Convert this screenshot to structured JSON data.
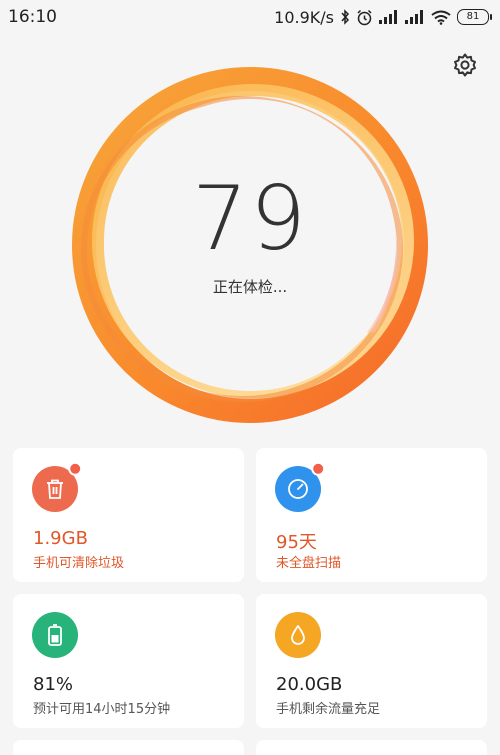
{
  "status_bar": {
    "time": "16:10",
    "network_speed": "10.9K/s",
    "battery_level": "81",
    "icons": [
      "bluetooth-icon",
      "alarm-icon",
      "signal-icon",
      "signal-icon",
      "wifi-icon",
      "battery-icon"
    ]
  },
  "score": {
    "value": "79",
    "status": "正在体检..."
  },
  "cards": [
    {
      "value": "1.9GB",
      "label": "手机可清除垃圾",
      "icon": "trash-icon",
      "color": "#ee6a4e",
      "has_badge": true,
      "emphasis": true
    },
    {
      "value": "95天",
      "label": "未全盘扫描",
      "icon": "scan-gauge-icon",
      "color": "#2f93ee",
      "has_badge": true,
      "emphasis": true
    },
    {
      "value": "81%",
      "label": "预计可用14小时15分钟",
      "icon": "battery-icon",
      "color": "#27b37a",
      "has_badge": false,
      "emphasis": false
    },
    {
      "value": "20.0GB",
      "label": "手机剩余流量充足",
      "icon": "water-drop-icon",
      "color": "#f5a623",
      "has_badge": false,
      "emphasis": false
    }
  ],
  "colors": {
    "ring_outer": "#f98c2c",
    "ring_inner": "#fdd27a",
    "background": "#f5f5f5",
    "warning_text": "#e0572a"
  }
}
